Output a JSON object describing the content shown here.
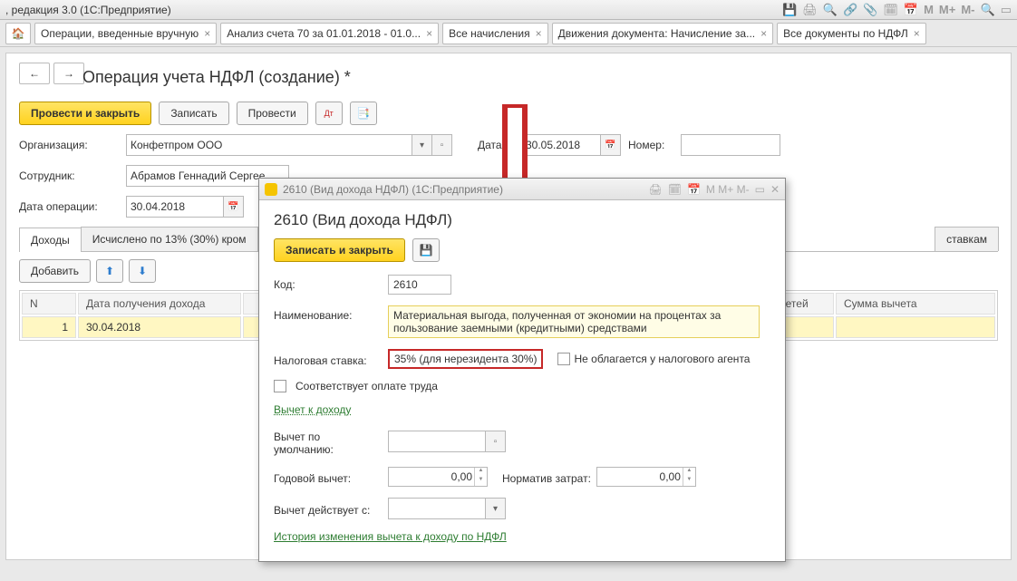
{
  "titlebar": {
    "text": ", редакция 3.0  (1С:Предприятие)"
  },
  "tabs": [
    "Операции, введенные вручную",
    "Анализ счета 70 за 01.01.2018 - 01.0...",
    "Все начисления",
    "Движения документа: Начисление за...",
    "Все документы по НДФЛ"
  ],
  "page": {
    "title": "Операция учета НДФЛ (создание) *",
    "btn_post_close": "Провести и закрыть",
    "btn_write": "Записать",
    "btn_post": "Провести",
    "lbl_org": "Организация:",
    "val_org": "Конфетпром ООО",
    "lbl_date": "Дата:",
    "val_date": "30.05.2018",
    "lbl_num": "Номер:",
    "lbl_emp": "Сотрудник:",
    "val_emp": "Абрамов Геннадий Сергее",
    "lbl_opdate": "Дата операции:",
    "val_opdate": "30.04.2018"
  },
  "subtabs": {
    "t1": "Доходы",
    "t2": "Исчислено по 13% (30%) кром",
    "t_last": "ставкам"
  },
  "table_toolbar": {
    "add": "Добавить"
  },
  "table": {
    "cols": [
      "N",
      "Дата получения дохода",
      "Кол-во детей",
      "Сумма вычета"
    ],
    "row": {
      "n": "1",
      "date": "30.04.2018"
    }
  },
  "dialog": {
    "wintitle": "2610 (Вид дохода НДФЛ)  (1С:Предприятие)",
    "title": "2610 (Вид дохода НДФЛ)",
    "btn_save": "Записать и закрыть",
    "lbl_code": "Код:",
    "val_code": "2610",
    "lbl_name": "Наименование:",
    "val_name": "Материальная выгода, полученная от экономии на процентах за пользование заемными (кредитными) средствами",
    "lbl_rate": "Налоговая ставка:",
    "val_rate": "35% (для нерезидента 30%)",
    "cb_notax": "Не облагается у налогового агента",
    "cb_salary": "Соответствует оплате труда",
    "link_ded": "Вычет к доходу",
    "lbl_def": "Вычет по умолчанию:",
    "lbl_year": "Годовой вычет:",
    "val_year": "0,00",
    "lbl_norm": "Норматив затрат:",
    "val_norm": "0,00",
    "lbl_from": "Вычет действует с:",
    "link_hist": "История изменения вычета к доходу по НДФЛ"
  }
}
